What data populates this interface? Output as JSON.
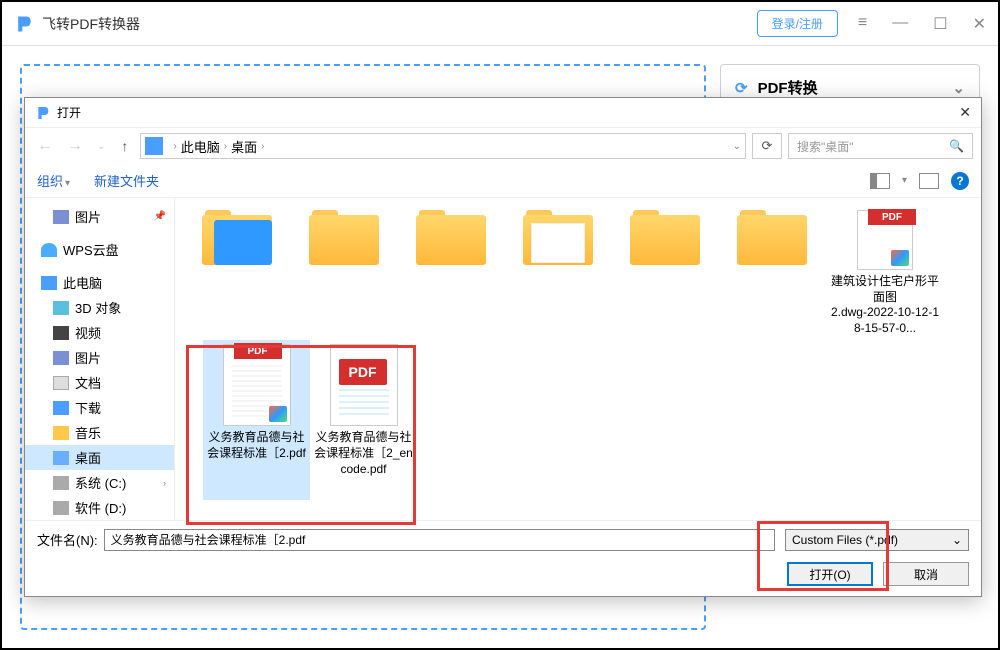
{
  "app": {
    "title": "飞转PDF转换器",
    "login": "登录/注册"
  },
  "sidepanel": {
    "title": "PDF转换"
  },
  "dialog": {
    "title": "打开",
    "breadcrumb": [
      "此电脑",
      "桌面"
    ],
    "search_placeholder": "搜索\"桌面\"",
    "toolbar": {
      "organize": "组织",
      "new_folder": "新建文件夹"
    },
    "sidebar": {
      "pictures": "图片",
      "wps": "WPS云盘",
      "thispc": "此电脑",
      "threed": "3D 对象",
      "video": "视频",
      "pictures2": "图片",
      "docs": "文档",
      "downloads": "下载",
      "music": "音乐",
      "desktop": "桌面",
      "cdrive": "系统 (C:)",
      "ddrive": "软件 (D:)"
    },
    "files": {
      "rightpdf": {
        "line1": "建筑设计住宅户形平面图",
        "line2": "2.dwg-2022-10-12-18-15-57-0..."
      },
      "pdf1": "义务教育品德与社会课程标准［2.pdf",
      "pdf2": "义务教育品德与社会课程标准［2_encode.pdf"
    },
    "pdf_label": "PDF",
    "filename_label": "文件名(N):",
    "filename_value": "义务教育品德与社会课程标准［2.pdf",
    "filter": "Custom Files (*.pdf)",
    "open_btn": "打开(O)",
    "cancel_btn": "取消"
  }
}
